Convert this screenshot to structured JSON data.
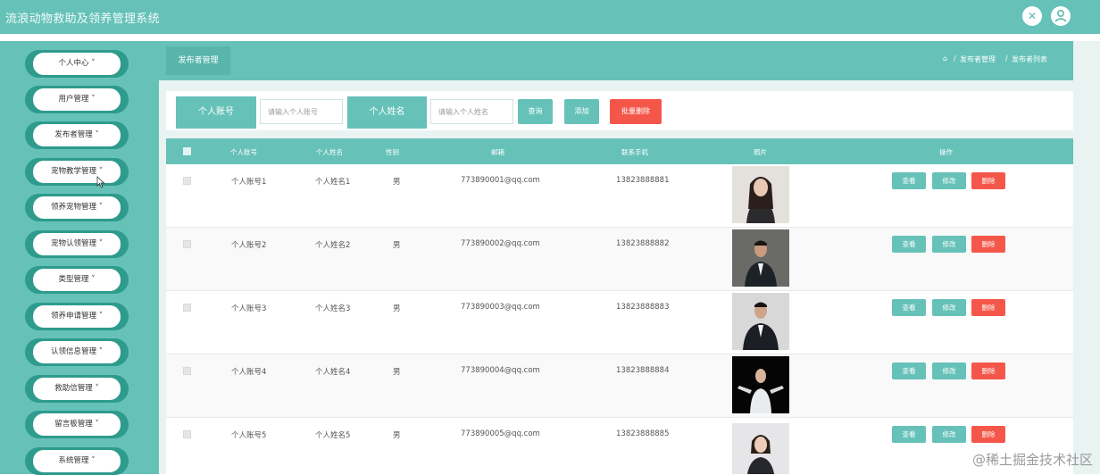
{
  "app": {
    "title": "流浪动物救助及领养管理系统"
  },
  "top_icons": [
    "settings-icon",
    "user-icon"
  ],
  "sidebar": {
    "items": [
      {
        "label": "个人中心 ˅"
      },
      {
        "label": "用户管理 ˅"
      },
      {
        "label": "发布者管理 ˅"
      },
      {
        "label": "宠物教学管理 ˅"
      },
      {
        "label": "领养宠物管理 ˅"
      },
      {
        "label": "宠物认领管理 ˅"
      },
      {
        "label": "类型管理 ˅"
      },
      {
        "label": "领养申请管理 ˅"
      },
      {
        "label": "认领信息管理 ˅"
      },
      {
        "label": "救助信管理 ˅"
      },
      {
        "label": "留言板管理 ˅"
      },
      {
        "label": "系统管理 ˅"
      }
    ]
  },
  "subheader": {
    "tab": "发布者管理"
  },
  "breadcrumb": {
    "home_icon": "⌂",
    "path1": "发布者管理",
    "sep": "/",
    "path2": "发布者列表"
  },
  "search": {
    "label1": "个人账号",
    "placeholder1": "请输入个人账号",
    "label2": "个人姓名",
    "placeholder2": "请输入个人姓名",
    "query_btn": "查询",
    "add_btn": "添加",
    "batch_delete_btn": "批量删除"
  },
  "table": {
    "columns": [
      "个人账号",
      "个人姓名",
      "性别",
      "邮箱",
      "联系手机",
      "照片",
      "操作"
    ],
    "rows": [
      {
        "account": "个人账号1",
        "name": "个人姓名1",
        "gender": "男",
        "email": "773890001@qq.com",
        "phone": "13823888881"
      },
      {
        "account": "个人账号2",
        "name": "个人姓名2",
        "gender": "男",
        "email": "773890002@qq.com",
        "phone": "13823888882"
      },
      {
        "account": "个人账号3",
        "name": "个人姓名3",
        "gender": "男",
        "email": "773890003@qq.com",
        "phone": "13823888883"
      },
      {
        "account": "个人账号4",
        "name": "个人姓名4",
        "gender": "男",
        "email": "773890004@qq.com",
        "phone": "13823888884"
      },
      {
        "account": "个人账号5",
        "name": "个人姓名5",
        "gender": "男",
        "email": "773890005@qq.com",
        "phone": "13823888885"
      }
    ],
    "actions": {
      "view": "查看",
      "edit": "修改",
      "delete": "删除"
    }
  },
  "watermark": "@稀土掘金技术社区",
  "colors": {
    "primary": "#66c2b9",
    "danger": "#f4574a",
    "sidebar_pill": "#2e9b8d"
  }
}
